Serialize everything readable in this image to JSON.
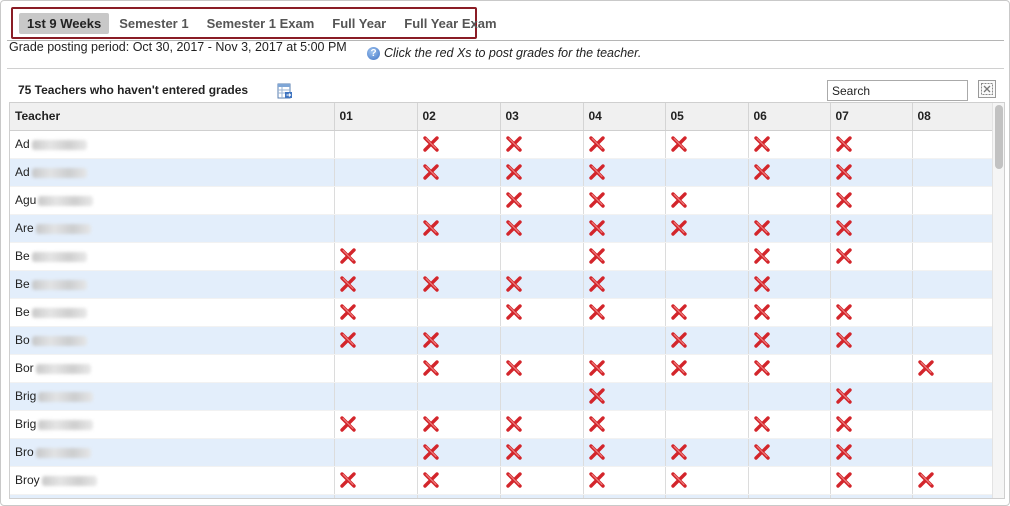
{
  "tabs": [
    {
      "label": "1st 9 Weeks",
      "active": true
    },
    {
      "label": "Semester 1",
      "active": false
    },
    {
      "label": "Semester 1 Exam",
      "active": false
    },
    {
      "label": "Full Year",
      "active": false
    },
    {
      "label": "Full Year Exam",
      "active": false
    }
  ],
  "posting_period": "Grade posting period: Oct 30, 2017 - Nov 3, 2017 at 5:00 PM",
  "help_text": "Click the red Xs to post grades for the teacher.",
  "teachers_title": "75 Teachers who haven't entered grades",
  "search": {
    "value": "Search"
  },
  "table": {
    "columns": [
      "Teacher",
      "01",
      "02",
      "03",
      "04",
      "05",
      "06",
      "07",
      "08"
    ],
    "rows": [
      {
        "teacher": "Ad",
        "marks": [
          0,
          1,
          1,
          1,
          1,
          1,
          1,
          0
        ]
      },
      {
        "teacher": "Ad",
        "marks": [
          0,
          1,
          1,
          1,
          0,
          1,
          1,
          0
        ]
      },
      {
        "teacher": "Agu",
        "marks": [
          0,
          0,
          1,
          1,
          1,
          0,
          1,
          0
        ]
      },
      {
        "teacher": "Are",
        "marks": [
          0,
          1,
          1,
          1,
          1,
          1,
          1,
          0
        ]
      },
      {
        "teacher": "Be",
        "marks": [
          1,
          0,
          0,
          1,
          0,
          1,
          1,
          0
        ]
      },
      {
        "teacher": "Be",
        "marks": [
          1,
          1,
          1,
          1,
          0,
          1,
          0,
          0
        ]
      },
      {
        "teacher": "Be",
        "marks": [
          1,
          0,
          1,
          1,
          1,
          1,
          1,
          0
        ]
      },
      {
        "teacher": "Bo",
        "marks": [
          1,
          1,
          0,
          0,
          1,
          1,
          1,
          0
        ]
      },
      {
        "teacher": "Bor",
        "marks": [
          0,
          1,
          1,
          1,
          1,
          1,
          0,
          1
        ]
      },
      {
        "teacher": "Brig",
        "marks": [
          0,
          0,
          0,
          1,
          0,
          0,
          1,
          0
        ]
      },
      {
        "teacher": "Brig",
        "marks": [
          1,
          1,
          1,
          1,
          0,
          1,
          1,
          0
        ]
      },
      {
        "teacher": "Bro",
        "marks": [
          0,
          1,
          1,
          1,
          1,
          1,
          1,
          0
        ]
      },
      {
        "teacher": "Broy",
        "marks": [
          1,
          1,
          1,
          1,
          1,
          0,
          1,
          1
        ]
      },
      {
        "teacher": "",
        "marks": [
          0,
          0,
          0,
          0,
          0,
          0,
          0,
          0
        ]
      }
    ]
  },
  "colors": {
    "tab_border": "#8a1c25",
    "alt_row": "#e3eefb",
    "x_mark": "#d3252b"
  },
  "icons": {
    "help": "help-circle-icon",
    "export": "export-grid-icon",
    "clear": "clear-search-icon",
    "post": "red-x-icon"
  }
}
